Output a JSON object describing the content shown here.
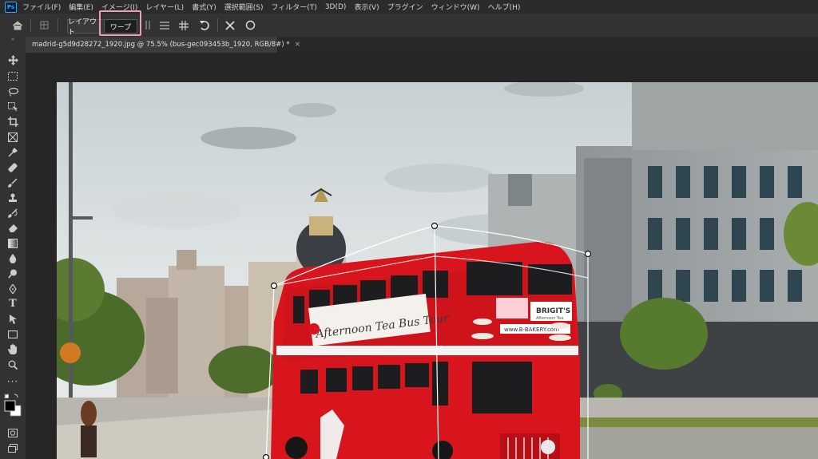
{
  "app": {
    "logo": "Ps"
  },
  "menu": [
    "ファイル(F)",
    "編集(E)",
    "イメージ(I)",
    "レイヤー(L)",
    "書式(Y)",
    "選択範囲(S)",
    "フィルター(T)",
    "3D(D)",
    "表示(V)",
    "プラグイン",
    "ウィンドウ(W)",
    "ヘルプ(H)"
  ],
  "options": {
    "layout_label": "レイアウト",
    "warp_label": "ワープ",
    "icons": [
      "home-icon",
      "transform-mode-icon",
      "vertical-split-icon",
      "horizontal-split-icon",
      "grid-split-icon",
      "reset-rotate-icon",
      "cancel-icon",
      "commit-icon"
    ]
  },
  "document": {
    "tab_title": "madrid-g5d9d28272_1920.jpg @ 75.5% (bus-gec093453b_1920, RGB/8#) *",
    "close": "×"
  },
  "tools": [
    "move-tool-icon",
    "marquee-tool-icon",
    "lasso-tool-icon",
    "object-select-tool-icon",
    "crop-tool-icon",
    "frame-tool-icon",
    "eyedropper-tool-icon",
    "healing-brush-tool-icon",
    "brush-tool-icon",
    "clone-stamp-tool-icon",
    "history-brush-tool-icon",
    "eraser-tool-icon",
    "gradient-tool-icon",
    "blur-tool-icon",
    "dodge-tool-icon",
    "pen-tool-icon",
    "type-tool-icon",
    "path-select-tool-icon",
    "rectangle-tool-icon",
    "hand-tool-icon",
    "zoom-tool-icon",
    "more-tools-icon",
    "color-swatches-icon",
    "quick-mask-icon",
    "screen-mode-icon"
  ],
  "photo_text": {
    "bus_banner": "Afternoon Tea Bus Tour",
    "bus_brand": "BRIGIT'S",
    "bus_brand_sub": "Afternoon Tea",
    "bus_url": "www.B-BAKERY.com"
  },
  "colors": {
    "accent_highlight": "#f2a0b0",
    "bus_red": "#d8141c"
  }
}
